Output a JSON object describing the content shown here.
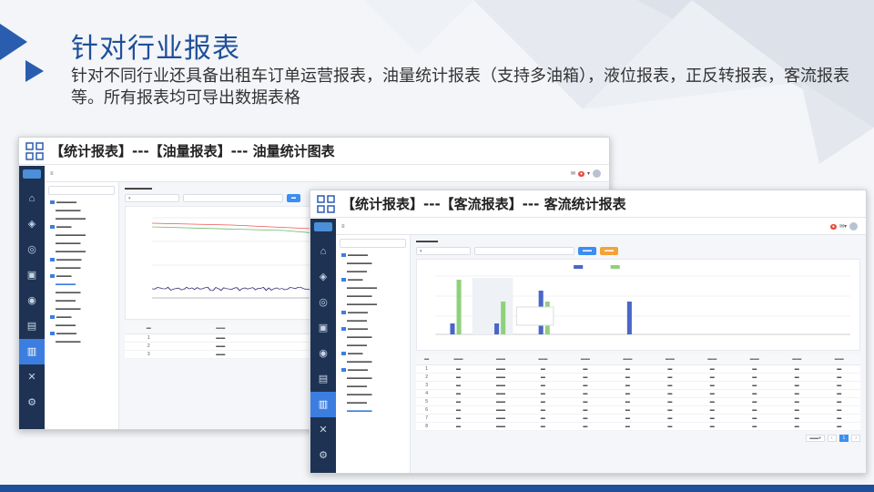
{
  "title": "针对行业报表",
  "description": "针对不同行业还具备出租车订单运营报表，油量统计报表（支持多油箱），液位报表，正反转报表，客流报表等。所有报表均可导出数据表格",
  "colors": {
    "brand": "#1f4f9a",
    "accent": "#3c7ee0",
    "sidebar": "#1e3354",
    "fuel_line": "#3a2a7a",
    "series_green": "#8fd17a",
    "series_blue": "#4a66c8"
  },
  "screenshot_fuel": {
    "caption": "【统计报表】---【油量报表】--- 油量统计图表",
    "sidebar_icons": [
      "home-icon",
      "vehicle-icon",
      "track-icon",
      "video-icon",
      "alarm-icon",
      "report-icon",
      "stats-icon",
      "tools-icon",
      "settings-icon"
    ],
    "active_index": 7
  },
  "screenshot_passenger": {
    "caption": "【统计报表】---【客流报表】--- 客流统计报表",
    "sidebar_icons": [
      "home-icon",
      "vehicle-icon",
      "track-icon",
      "video-icon",
      "alarm-icon",
      "report-icon",
      "stats-icon",
      "tools-icon",
      "settings-icon"
    ],
    "active_index": 6
  }
}
